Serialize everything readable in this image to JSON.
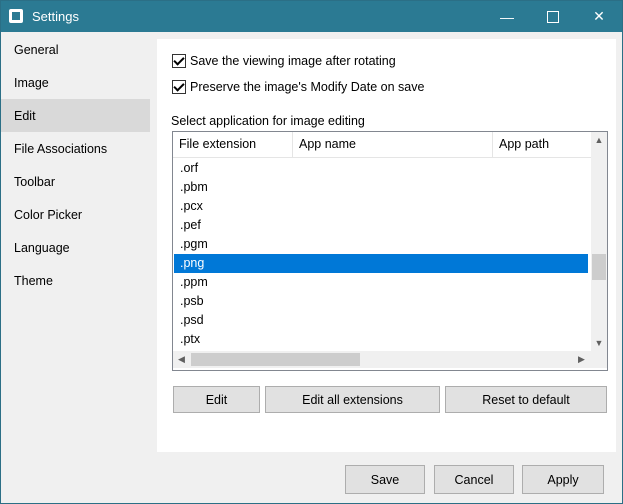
{
  "window": {
    "title": "Settings",
    "minimize": "—",
    "close": "✕"
  },
  "sidebar": {
    "items": [
      {
        "label": "General"
      },
      {
        "label": "Image"
      },
      {
        "label": "Edit"
      },
      {
        "label": "File Associations"
      },
      {
        "label": "Toolbar"
      },
      {
        "label": "Color Picker"
      },
      {
        "label": "Language"
      },
      {
        "label": "Theme"
      }
    ],
    "selected": "Edit"
  },
  "edit": {
    "save_rotating": "Save the viewing image after rotating",
    "save_rotating_checked": true,
    "preserve_date": "Preserve the image's Modify Date on save",
    "preserve_date_checked": true,
    "section_label": "Select application for image editing",
    "columns": [
      "File extension",
      "App name",
      "App path"
    ],
    "rows": [
      ".orf",
      ".pbm",
      ".pcx",
      ".pef",
      ".pgm",
      ".png",
      ".ppm",
      ".psb",
      ".psd",
      ".ptx"
    ],
    "selected_row": ".png",
    "buttons": {
      "edit": "Edit",
      "edit_all": "Edit all extensions",
      "reset": "Reset to default"
    }
  },
  "footer": {
    "save": "Save",
    "cancel": "Cancel",
    "apply": "Apply"
  },
  "icons": {
    "scroll_up": "▲",
    "scroll_down": "▼",
    "scroll_left": "◀",
    "scroll_right": "▶"
  },
  "colors": {
    "titlebar": "#2b7a93",
    "selection": "#0078d7",
    "sidebar_selected": "#d9d9d9"
  }
}
